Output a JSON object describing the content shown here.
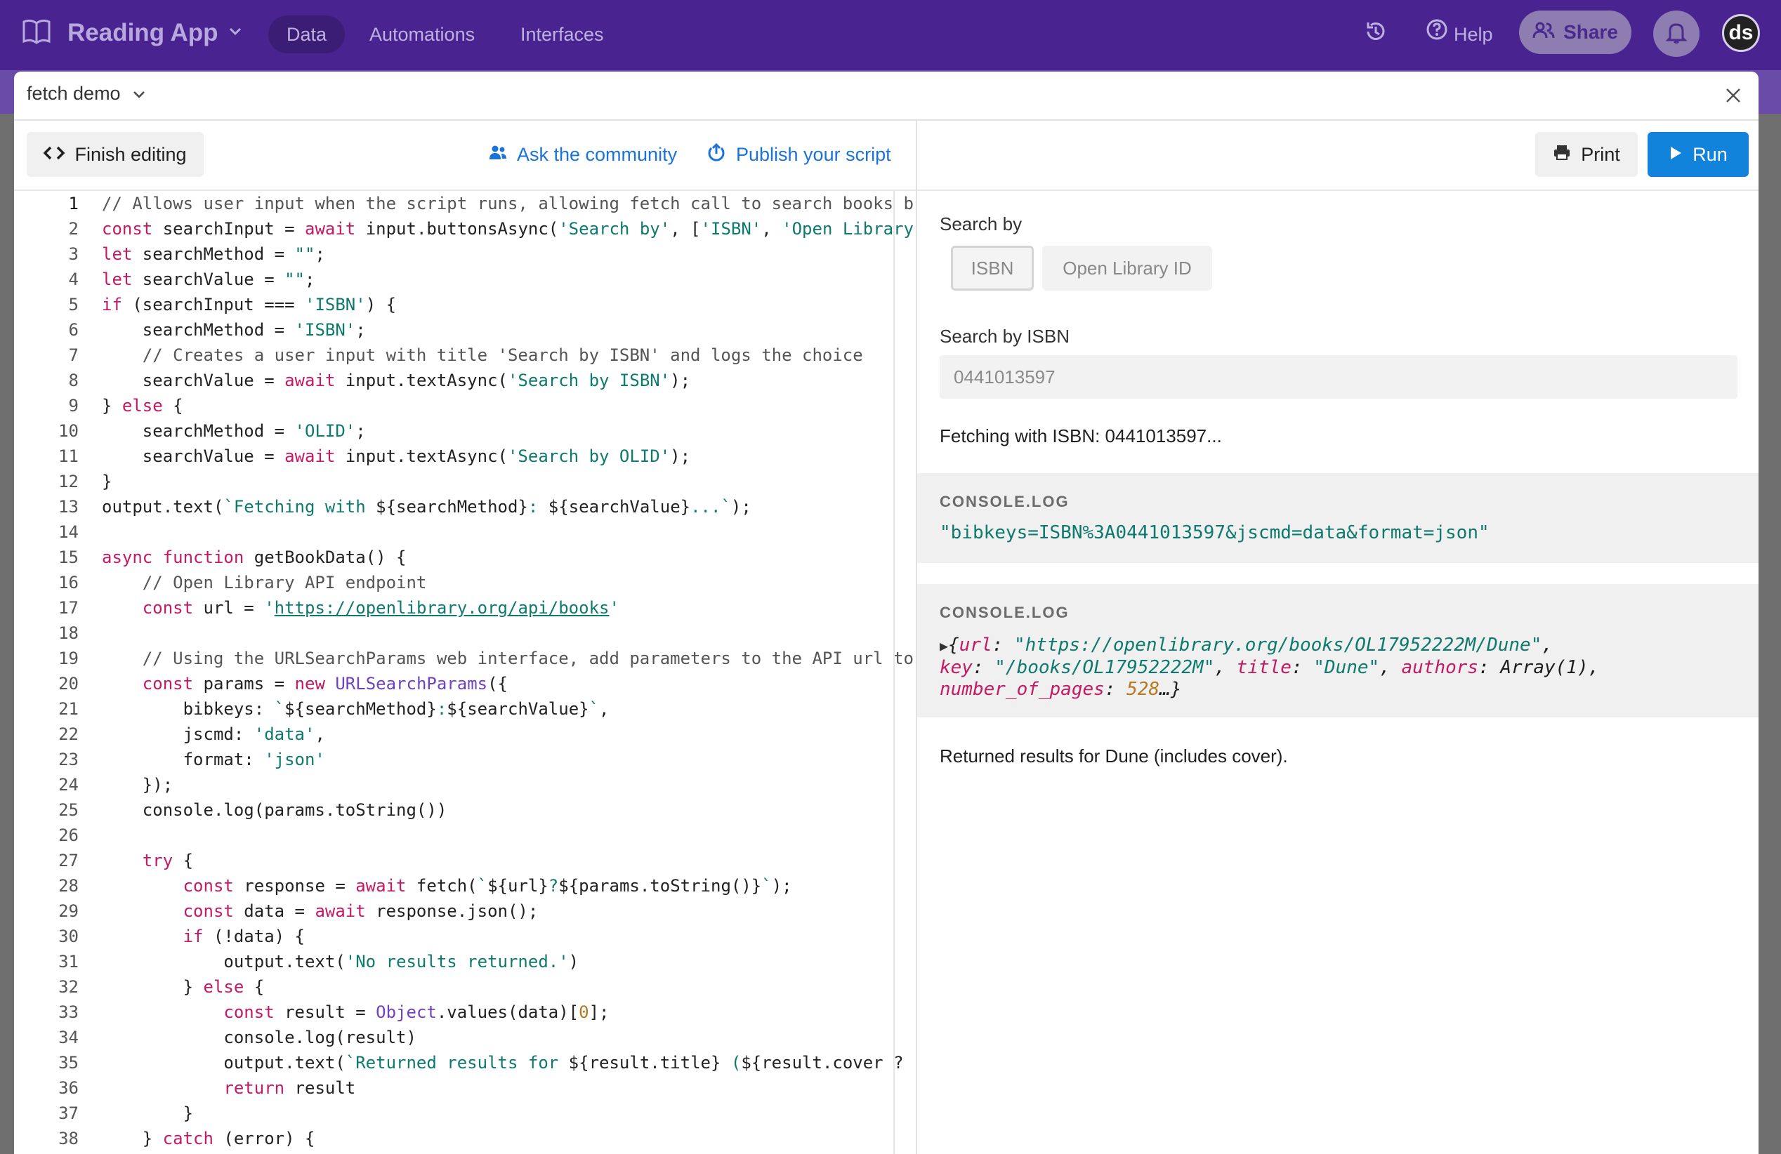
{
  "app": {
    "title": "Reading App",
    "nav": [
      "Data",
      "Automations",
      "Interfaces"
    ],
    "help_label": "Help",
    "share_label": "Share",
    "avatar_initials": "ds",
    "colors": {
      "topbar": "#49238f",
      "run": "#1283da",
      "link": "#1a73d9"
    }
  },
  "modal": {
    "title": "fetch demo",
    "finish_label": "Finish editing",
    "ask_label": "Ask the community",
    "publish_label": "Publish your script",
    "print_label": "Print",
    "run_label": "Run"
  },
  "code": {
    "active_line": 1,
    "lines": [
      [
        [
          "com",
          "// Allows user input when the script runs, allowing fetch call to search books b"
        ]
      ],
      [
        [
          "kw",
          "const"
        ],
        [
          "p",
          " searchInput = "
        ],
        [
          "kw",
          "await"
        ],
        [
          "p",
          " input.buttonsAsync("
        ],
        [
          "str",
          "'Search by'"
        ],
        [
          "p",
          ", ["
        ],
        [
          "str",
          "'ISBN'"
        ],
        [
          "p",
          ", "
        ],
        [
          "str",
          "'Open Library"
        ]
      ],
      [
        [
          "kw",
          "let"
        ],
        [
          "p",
          " searchMethod = "
        ],
        [
          "str",
          "\"\""
        ],
        [
          "p",
          ";"
        ]
      ],
      [
        [
          "kw",
          "let"
        ],
        [
          "p",
          " searchValue = "
        ],
        [
          "str",
          "\"\""
        ],
        [
          "p",
          ";"
        ]
      ],
      [
        [
          "kw",
          "if"
        ],
        [
          "p",
          " (searchInput === "
        ],
        [
          "str",
          "'ISBN'"
        ],
        [
          "p",
          ") {"
        ]
      ],
      [
        [
          "p",
          "    searchMethod = "
        ],
        [
          "str",
          "'ISBN'"
        ],
        [
          "p",
          ";"
        ]
      ],
      [
        [
          "com",
          "    // Creates a user input with title 'Search by ISBN' and logs the choice"
        ]
      ],
      [
        [
          "p",
          "    searchValue = "
        ],
        [
          "kw",
          "await"
        ],
        [
          "p",
          " input.textAsync("
        ],
        [
          "str",
          "'Search by ISBN'"
        ],
        [
          "p",
          ");"
        ]
      ],
      [
        [
          "p",
          "} "
        ],
        [
          "kw",
          "else"
        ],
        [
          "p",
          " {"
        ]
      ],
      [
        [
          "p",
          "    searchMethod = "
        ],
        [
          "str",
          "'OLID'"
        ],
        [
          "p",
          ";"
        ]
      ],
      [
        [
          "p",
          "    searchValue = "
        ],
        [
          "kw",
          "await"
        ],
        [
          "p",
          " input.textAsync("
        ],
        [
          "str",
          "'Search by OLID'"
        ],
        [
          "p",
          ");"
        ]
      ],
      [
        [
          "p",
          "}"
        ]
      ],
      [
        [
          "p",
          "output.text("
        ],
        [
          "str",
          "`Fetching with "
        ],
        [
          "p",
          "${searchMethod}"
        ],
        [
          "str",
          ": "
        ],
        [
          "p",
          "${searchValue}"
        ],
        [
          "str",
          "...`"
        ],
        [
          "p",
          ");"
        ]
      ],
      [
        [
          "p",
          ""
        ]
      ],
      [
        [
          "kw",
          "async"
        ],
        [
          "p",
          " "
        ],
        [
          "kw",
          "function"
        ],
        [
          "p",
          " getBookData() {"
        ]
      ],
      [
        [
          "com",
          "    // Open Library API endpoint"
        ]
      ],
      [
        [
          "p",
          "    "
        ],
        [
          "kw",
          "const"
        ],
        [
          "p",
          " url = "
        ],
        [
          "str",
          "'"
        ],
        [
          "url",
          "https://openlibrary.org/api/books"
        ],
        [
          "str",
          "'"
        ]
      ],
      [
        [
          "p",
          ""
        ]
      ],
      [
        [
          "com",
          "    // Using the URLSearchParams web interface, add parameters to the API url to"
        ]
      ],
      [
        [
          "p",
          "    "
        ],
        [
          "kw",
          "const"
        ],
        [
          "p",
          " params = "
        ],
        [
          "kw",
          "new"
        ],
        [
          "p",
          " "
        ],
        [
          "cls",
          "URLSearchParams"
        ],
        [
          "p",
          "({"
        ]
      ],
      [
        [
          "p",
          "        bibkeys: "
        ],
        [
          "str",
          "`"
        ],
        [
          "p",
          "${searchMethod}"
        ],
        [
          "str",
          ":"
        ],
        [
          "p",
          "${searchValue}"
        ],
        [
          "str",
          "`"
        ],
        [
          "p",
          ","
        ]
      ],
      [
        [
          "p",
          "        jscmd: "
        ],
        [
          "str",
          "'data'"
        ],
        [
          "p",
          ","
        ]
      ],
      [
        [
          "p",
          "        format: "
        ],
        [
          "str",
          "'json'"
        ]
      ],
      [
        [
          "p",
          "    });"
        ]
      ],
      [
        [
          "p",
          "    console.log(params.toString())"
        ]
      ],
      [
        [
          "p",
          ""
        ]
      ],
      [
        [
          "p",
          "    "
        ],
        [
          "kw",
          "try"
        ],
        [
          "p",
          " {"
        ]
      ],
      [
        [
          "p",
          "        "
        ],
        [
          "kw",
          "const"
        ],
        [
          "p",
          " response = "
        ],
        [
          "kw",
          "await"
        ],
        [
          "p",
          " fetch("
        ],
        [
          "str",
          "`"
        ],
        [
          "p",
          "${url}"
        ],
        [
          "str",
          "?"
        ],
        [
          "p",
          "${params.toString()}"
        ],
        [
          "str",
          "`"
        ],
        [
          "p",
          ");"
        ]
      ],
      [
        [
          "p",
          "        "
        ],
        [
          "kw",
          "const"
        ],
        [
          "p",
          " data = "
        ],
        [
          "kw",
          "await"
        ],
        [
          "p",
          " response.json();"
        ]
      ],
      [
        [
          "p",
          "        "
        ],
        [
          "kw",
          "if"
        ],
        [
          "p",
          " (!data) {"
        ]
      ],
      [
        [
          "p",
          "            output.text("
        ],
        [
          "str",
          "'No results returned.'"
        ],
        [
          "p",
          ")"
        ]
      ],
      [
        [
          "p",
          "        } "
        ],
        [
          "kw",
          "else"
        ],
        [
          "p",
          " {"
        ]
      ],
      [
        [
          "p",
          "            "
        ],
        [
          "kw",
          "const"
        ],
        [
          "p",
          " result = "
        ],
        [
          "cls",
          "Object"
        ],
        [
          "p",
          ".values(data)["
        ],
        [
          "num",
          "0"
        ],
        [
          "p",
          "];"
        ]
      ],
      [
        [
          "p",
          "            console.log(result)"
        ]
      ],
      [
        [
          "p",
          "            output.text("
        ],
        [
          "str",
          "`Returned results for "
        ],
        [
          "p",
          "${result.title}"
        ],
        [
          "str",
          " ("
        ],
        [
          "p",
          "${result.cover ?"
        ]
      ],
      [
        [
          "p",
          "            "
        ],
        [
          "kw",
          "return"
        ],
        [
          "p",
          " result"
        ]
      ],
      [
        [
          "p",
          "        }"
        ]
      ],
      [
        [
          "p",
          "    } "
        ],
        [
          "kw",
          "catch"
        ],
        [
          "p",
          " (error) {"
        ]
      ]
    ]
  },
  "output": {
    "search_by_label": "Search by",
    "choices": [
      "ISBN",
      "Open Library ID"
    ],
    "search_isbn_label": "Search by ISBN",
    "isbn_value": "0441013597",
    "fetching_text": "Fetching with ISBN: 0441013597...",
    "log1_head": "CONSOLE.LOG",
    "log1_value": "\"bibkeys=ISBN%3A0441013597&jscmd=data&format=json\"",
    "log2_head": "CONSOLE.LOG",
    "log2_object": {
      "url_key": "url",
      "url_value": "\"https://openlibrary.org/books/OL17952222M/Dune\"",
      "key_key": "key",
      "key_value": "\"/books/OL17952222M\"",
      "title_key": "title",
      "title_value": "\"Dune\"",
      "authors_key": "authors",
      "authors_value": "Array(1)",
      "pages_key": "number_of_pages",
      "pages_value": "528"
    },
    "result_text": "Returned results for Dune (includes cover)."
  }
}
